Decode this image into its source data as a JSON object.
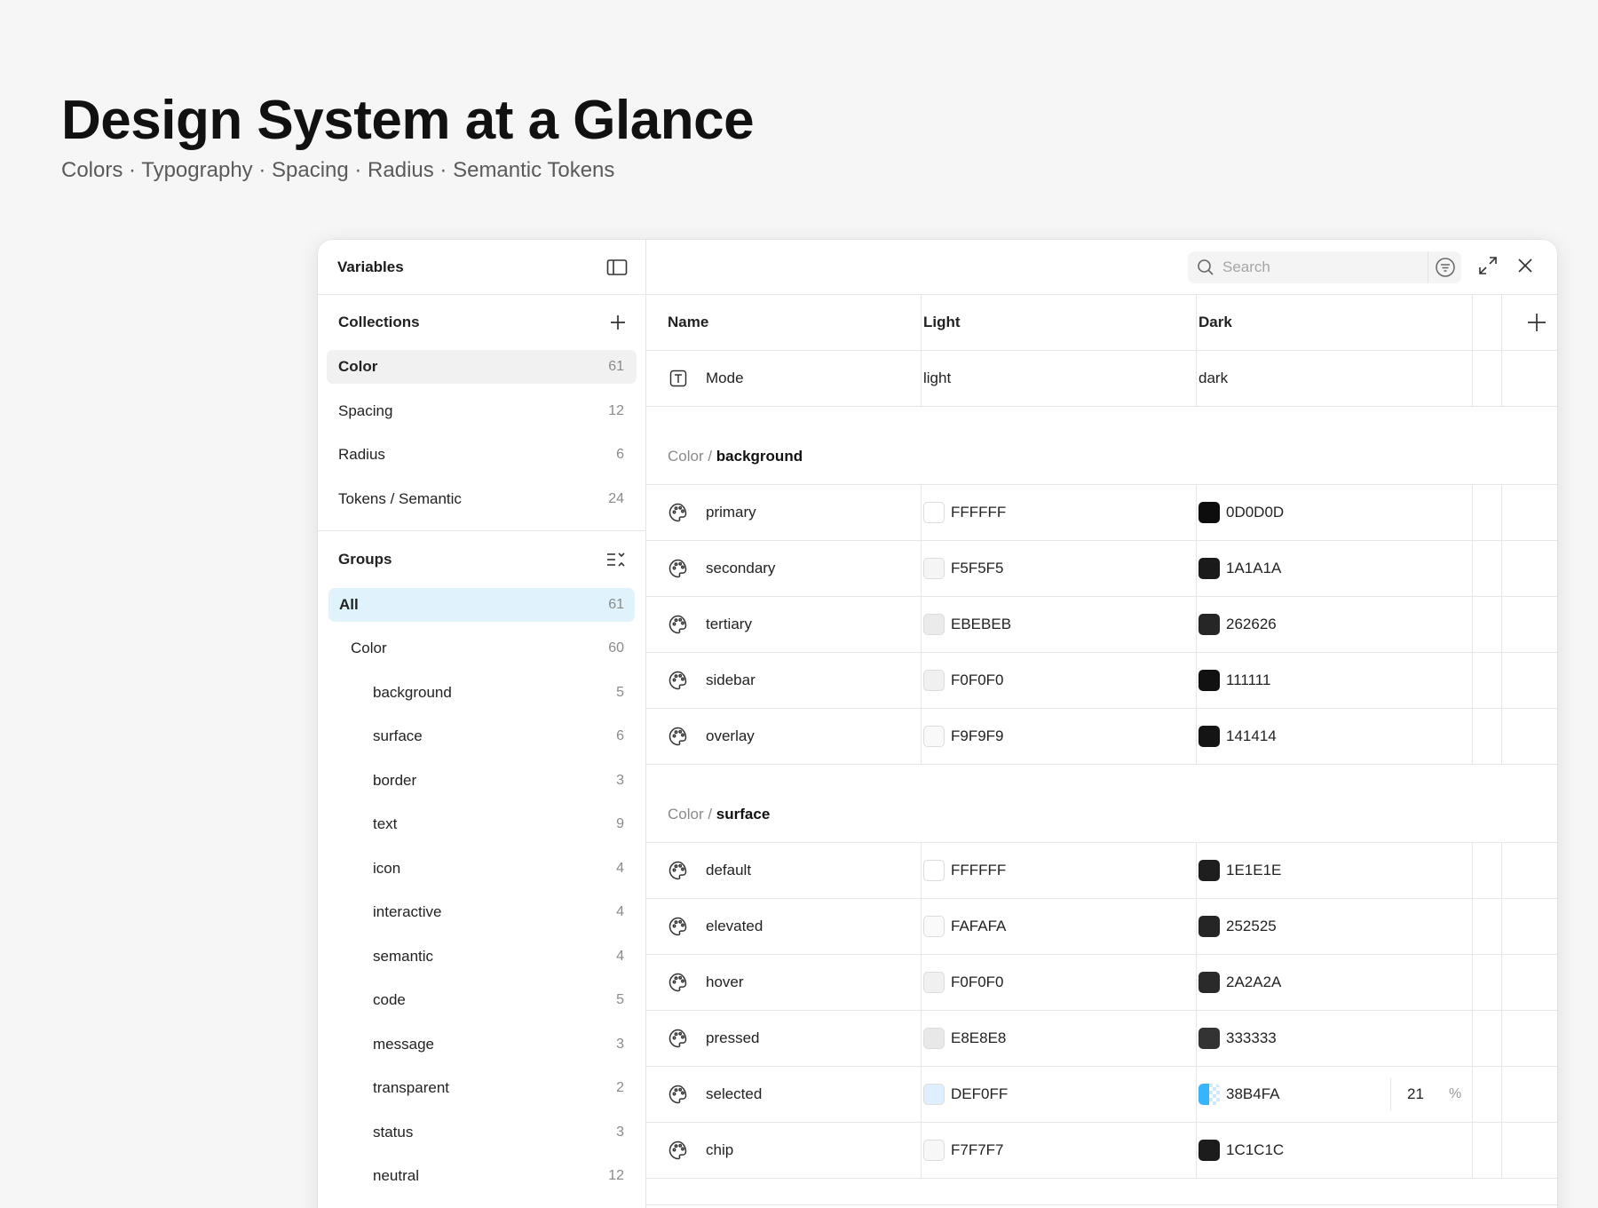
{
  "hero": {
    "title": "Design System at a Glance",
    "subtitle": "Colors · Typography · Spacing · Radius · Semantic Tokens"
  },
  "sidebar": {
    "title": "Variables",
    "collections_title": "Collections",
    "collections": [
      {
        "label": "Color",
        "count": "61"
      },
      {
        "label": "Spacing",
        "count": "12"
      },
      {
        "label": "Radius",
        "count": "6"
      },
      {
        "label": "Tokens / Semantic",
        "count": "24"
      }
    ],
    "groups_title": "Groups",
    "groups": [
      {
        "label": "All",
        "count": "61"
      },
      {
        "label": "Color",
        "count": "60"
      },
      {
        "label": "background",
        "count": "5"
      },
      {
        "label": "surface",
        "count": "6"
      },
      {
        "label": "border",
        "count": "3"
      },
      {
        "label": "text",
        "count": "9"
      },
      {
        "label": "icon",
        "count": "4"
      },
      {
        "label": "interactive",
        "count": "4"
      },
      {
        "label": "semantic",
        "count": "4"
      },
      {
        "label": "code",
        "count": "5"
      },
      {
        "label": "message",
        "count": "3"
      },
      {
        "label": "transparent",
        "count": "2"
      },
      {
        "label": "status",
        "count": "3"
      },
      {
        "label": "neutral",
        "count": "12"
      }
    ]
  },
  "toolbar": {
    "search_placeholder": "Search"
  },
  "table": {
    "columns": {
      "name": "Name",
      "light": "Light",
      "dark": "Dark"
    },
    "mode_row": {
      "name": "Mode",
      "light": "light",
      "dark": "dark"
    },
    "groups": [
      {
        "parent": "Color",
        "separator": " / ",
        "name": "background",
        "rows": [
          {
            "name": "primary",
            "light": "FFFFFF",
            "dark": "0D0D0D",
            "light_color": "#FFFFFF",
            "dark_color": "#0D0D0D"
          },
          {
            "name": "secondary",
            "light": "F5F5F5",
            "dark": "1A1A1A",
            "light_color": "#F5F5F5",
            "dark_color": "#1A1A1A"
          },
          {
            "name": "tertiary",
            "light": "EBEBEB",
            "dark": "262626",
            "light_color": "#EBEBEB",
            "dark_color": "#262626"
          },
          {
            "name": "sidebar",
            "light": "F0F0F0",
            "dark": "111111",
            "light_color": "#F0F0F0",
            "dark_color": "#111111"
          },
          {
            "name": "overlay",
            "light": "F9F9F9",
            "dark": "141414",
            "light_color": "#F9F9F9",
            "dark_color": "#141414"
          }
        ]
      },
      {
        "parent": "Color",
        "separator": " / ",
        "name": "surface",
        "rows": [
          {
            "name": "default",
            "light": "FFFFFF",
            "dark": "1E1E1E",
            "light_color": "#FFFFFF",
            "dark_color": "#1E1E1E"
          },
          {
            "name": "elevated",
            "light": "FAFAFA",
            "dark": "252525",
            "light_color": "#FAFAFA",
            "dark_color": "#252525"
          },
          {
            "name": "hover",
            "light": "F0F0F0",
            "dark": "2A2A2A",
            "light_color": "#F0F0F0",
            "dark_color": "#2A2A2A"
          },
          {
            "name": "pressed",
            "light": "E8E8E8",
            "dark": "333333",
            "light_color": "#E8E8E8",
            "dark_color": "#333333"
          },
          {
            "name": "selected",
            "light": "DEF0FF",
            "dark": "38B4FA",
            "light_color": "#DEF0FF",
            "dark_color": "#38B4FA",
            "dark_opacity": "21",
            "opacity_unit": "%"
          },
          {
            "name": "chip",
            "light": "F7F7F7",
            "dark": "1C1C1C",
            "light_color": "#F7F7F7",
            "dark_color": "#1C1C1C"
          }
        ]
      }
    ]
  }
}
